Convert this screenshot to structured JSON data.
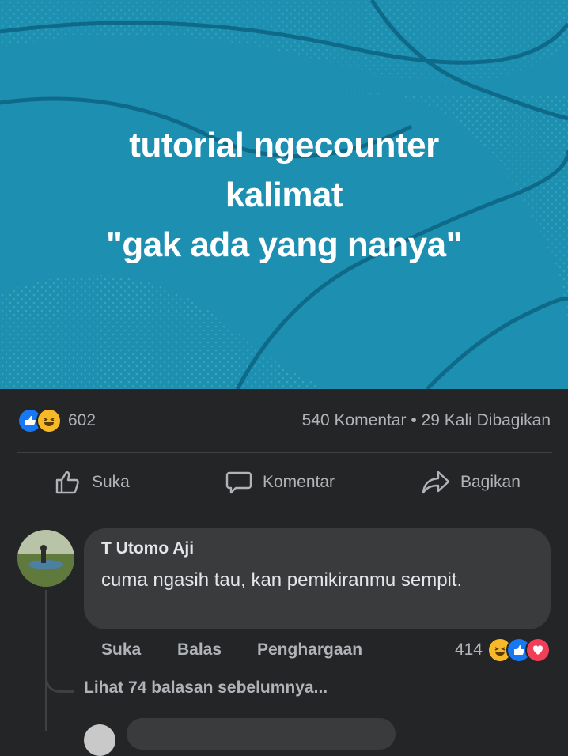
{
  "post": {
    "text_lines": [
      "tutorial ngecounter",
      "kalimat",
      "\"gak ada yang nanya\""
    ],
    "background_color": "#1d8fb1"
  },
  "stats": {
    "reaction_count": "602",
    "comments_shares": "540 Komentar • 29 Kali Dibagikan"
  },
  "actions": {
    "like": "Suka",
    "comment": "Komentar",
    "share": "Bagikan"
  },
  "comment": {
    "author": "T Utomo Aji",
    "body": "cuma ngasih tau, kan pemikiranmu sempit.",
    "like": "Suka",
    "reply": "Balas",
    "award": "Penghargaan",
    "reaction_count": "414"
  },
  "replies": {
    "view_previous": "Lihat 74 balasan sebelumnya..."
  },
  "icons": {
    "reactions": [
      "like-icon",
      "haha-icon",
      "love-icon"
    ],
    "actions": [
      "thumbs-up-icon",
      "speech-bubble-icon",
      "share-arrow-icon"
    ]
  },
  "colors": {
    "panel": "#242526",
    "bubble": "#3a3b3c",
    "text_primary": "#e4e6eb",
    "text_secondary": "#b0b3b8",
    "like_blue": "#1877f2"
  }
}
